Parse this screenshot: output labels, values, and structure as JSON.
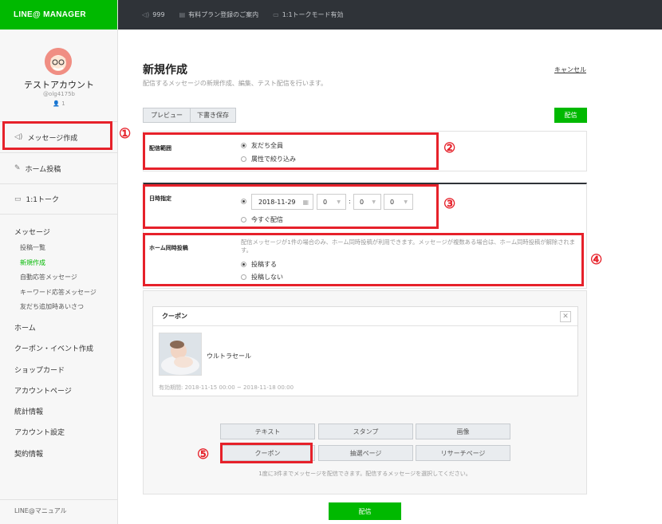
{
  "brand": "LINE@ MANAGER",
  "topbar": {
    "count": "999",
    "plan": "有料プラン登録のご案内",
    "talk_mode": "1:1トークモード有効"
  },
  "account": {
    "name": "テストアカウント",
    "id": "@olg4175b",
    "friends": "1"
  },
  "sidebar": {
    "message_create": "メッセージ作成",
    "home_post": "ホーム投稿",
    "talk": "1:1トーク",
    "messages_heading": "メッセージ",
    "messages_sub": [
      "投稿一覧",
      "新規作成",
      "自動応答メッセージ",
      "キーワード応答メッセージ",
      "友だち追加時あいさつ"
    ],
    "main": [
      "ホーム",
      "クーポン・イベント作成",
      "ショップカード",
      "アカウントページ",
      "統計情報",
      "アカウント設定",
      "契約情報"
    ],
    "footer": "LINE@マニュアル"
  },
  "page": {
    "title": "新規作成",
    "desc": "配信するメッセージの新規作成、編集、テスト配信を行います。",
    "cancel": "キャンセル"
  },
  "toolbar": {
    "preview": "プレビュー",
    "draft": "下書き保存",
    "send": "配信"
  },
  "scope": {
    "label": "配信範囲",
    "opt_all": "友だち全員",
    "opt_filter": "属性で絞り込み"
  },
  "schedule": {
    "label": "日時指定",
    "date": "2018-11-29",
    "hour": "0",
    "minute": "0",
    "second": "0",
    "now": "今すぐ配信"
  },
  "home_post": {
    "label": "ホーム同時投稿",
    "note": "配信メッセージが1件の場合のみ、ホーム同時投稿が利用できます。メッセージが複数ある場合は、ホーム同時投稿が解除されます。",
    "opt_yes": "投稿する",
    "opt_no": "投稿しない"
  },
  "coupon": {
    "header": "クーポン",
    "title": "ウルトラセール",
    "validity": "有効期間: 2018-11-15 00:00 ~ 2018-11-18 00:00"
  },
  "types": {
    "text": "テキスト",
    "stamp": "スタンプ",
    "image": "画像",
    "coupon": "クーポン",
    "lottery": "抽選ページ",
    "research": "リサーチページ"
  },
  "hint": "1度に3件までメッセージを配信できます。配信するメッセージを選択してください。",
  "bottom_send": "配信",
  "annotations": [
    "①",
    "②",
    "③",
    "④",
    "⑤"
  ],
  "colors": {
    "brand_green": "#00b900",
    "topbar": "#2f3338",
    "highlight_red": "#e6212a"
  }
}
